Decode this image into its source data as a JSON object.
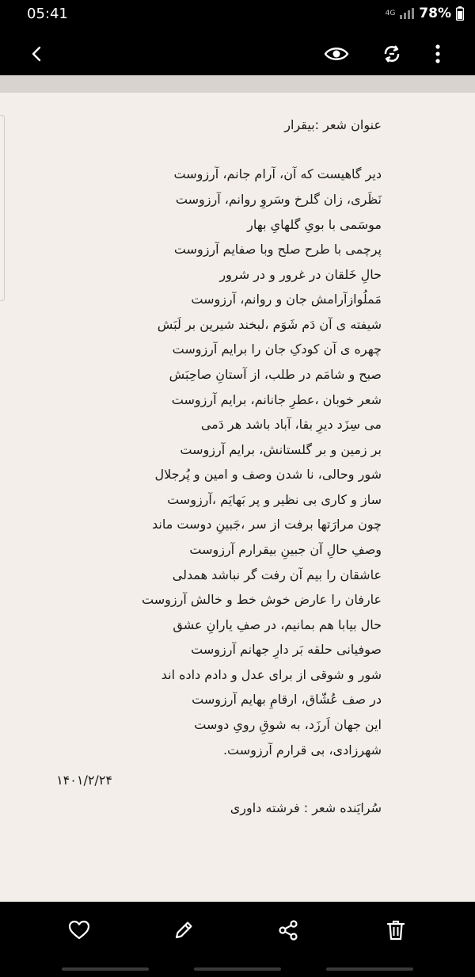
{
  "status_bar": {
    "time": "05:41",
    "network": "4G",
    "battery": "78%"
  },
  "top_bar": {
    "icons": [
      "back-arrow-icon",
      "eye-icon",
      "rotate-icon",
      "more-vert-icon"
    ]
  },
  "poem": {
    "title": "عنوان شعر :بیقرار",
    "lines": [
      "دیر گاهیست که آن، آرام جانم،  آرزوست",
      "نَظَری، زان گلرخ وسَروِ روانم،  آرزوست",
      "موسَمی با بویِ گلهایِ بهار",
      "پرچمی با طرح صلح وبا صفایم  آرزوست",
      "حالِ خَلقان در غرور و در شرور",
      "مَملُوازآرامش جان و روانم، آرزوست",
      "شیفته ی آن دَم شَوَم ،لبخند شیرین بر لَبَش",
      "چهره ی آن کودکِ جان را برایم آرزوست",
      "صبح و شامَم در طلب، از آستانِ صاحِبَش",
      "شعر خوبان ،عطرِ جانانم، برایم آرزوست",
      "می سِزَد دیرِ بقا، آباد باشد هر دَمی",
      "بر زمین و بر گلستانش، برایم آرزوست",
      "شور وحالی، نا شدن وصف و امین و پُرجلال",
      "ساز و کاری بی نظیر و پر بَهایَم ،آرزوست",
      "چون مرارَتها برفت از سر ،جَبینِ دوست ماند",
      "وصفِ حالِ آن جبینِ بیقرارم آرزوست",
      "عاشقان را بیم آن رفت گر نباشد همدلی",
      "عارفان را عارض خوش خط و خالش آرزوست",
      "حال بیابا هم بمانیم، در صفِ یارانِ عشق",
      "صوفیانی حلقه بَر دارِ جهانم آرزوست",
      "شور و شوقی از برای عدل و دادم داده اند",
      "در صف عُشّاق، ارقامِ بهایم آرزوست",
      "این جهان اَرزَد، به شوقِ رویِ دوست",
      "شهرزادی، بی قرارم آرزوست."
    ],
    "date": "۱۴۰۱/۲/۲۴",
    "author": "سُرایَنده شعر : فرشته داوری"
  },
  "bottom_bar": {
    "icons": [
      "heart-icon",
      "edit-pencil-icon",
      "share-icon",
      "trash-icon"
    ]
  }
}
